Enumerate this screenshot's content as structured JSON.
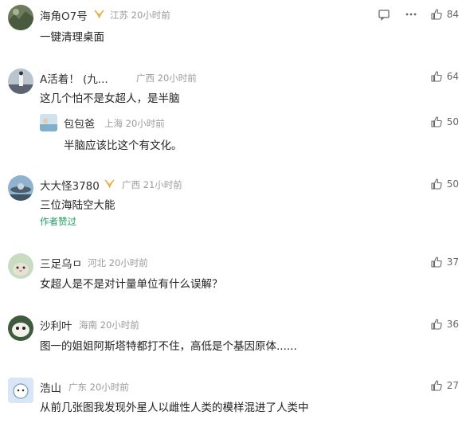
{
  "comments": [
    {
      "user": "海角O7号",
      "location": "江苏",
      "time": "20小时前",
      "text": "一键清理桌面",
      "likes": "84",
      "badge": "gold-wings-icon"
    },
    {
      "user": "A活着！  (九...",
      "location": "广西",
      "time": "20小时前",
      "text": "这几个怕不是女超人，是半脑",
      "likes": "64"
    },
    {
      "user": "包包爸",
      "location": "上海",
      "time": "20小时前",
      "text": "半脑应该比这个有文化。",
      "likes": "50",
      "is_reply": true
    },
    {
      "user": "大大怪3780",
      "location": "广西",
      "time": "21小时前",
      "text": "三位海陆空大能",
      "likes": "50",
      "badge": "gold-wings-icon",
      "author_liked": "作者赞过"
    },
    {
      "user": "三足乌ㅁ",
      "location": "河北",
      "time": "20小时前",
      "text": "女超人是不是对计量单位有什么误解？",
      "likes": "37"
    },
    {
      "user": "沙利叶",
      "location": "海南",
      "time": "20小时前",
      "text": "图一的姐姐阿斯塔特都打不住，高低是个基因原体......",
      "likes": "36"
    },
    {
      "user": "浩山",
      "location": "广东",
      "time": "20小时前",
      "text": "从前几张图我发现外星人以雌性人类的模样混进了人类中",
      "likes": "27"
    }
  ],
  "colors": {
    "meta": "#9a9a9a",
    "author_liked": "#1f9f5f",
    "badge": "#e6b04a"
  },
  "icons": [
    "reply-icon",
    "more-icon",
    "like-icon"
  ]
}
